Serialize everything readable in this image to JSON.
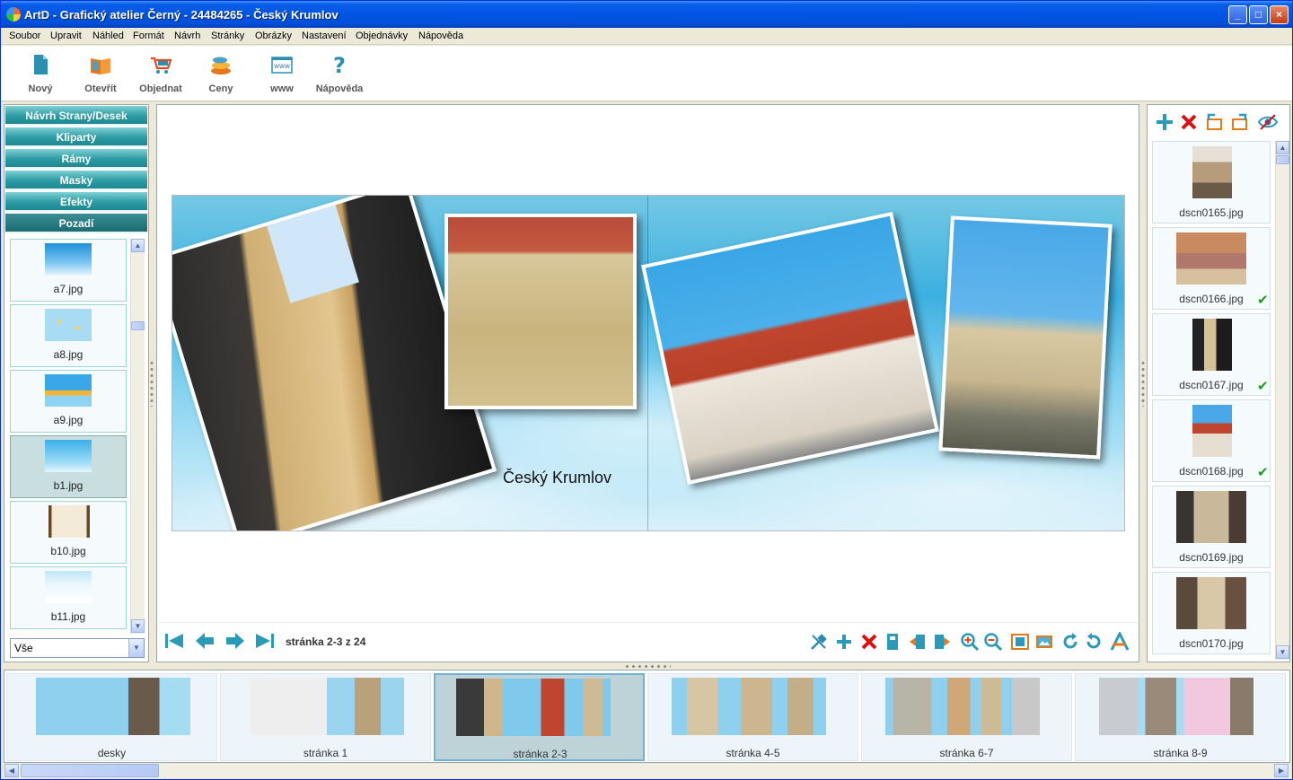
{
  "window": {
    "title": "ArtD - Grafický atelier Černý - 24484265 - Český Krumlov",
    "minimize": "_",
    "maximize": "□",
    "close": "×"
  },
  "menu": [
    "Soubor",
    "Upravit",
    "Náhled",
    "Formát",
    "Návrh",
    "Stránky",
    "Obrázky",
    "Nastavení",
    "Objednávky",
    "Nápověda"
  ],
  "toolbar": [
    {
      "label": "Nový",
      "icon": "new-document-icon"
    },
    {
      "label": "Otevřít",
      "icon": "open-book-icon"
    },
    {
      "label": "Objednat",
      "icon": "shopping-cart-icon"
    },
    {
      "label": "Ceny",
      "icon": "coins-icon"
    },
    {
      "label": "www",
      "icon": "web-browser-icon"
    },
    {
      "label": "Nápověda",
      "icon": "help-question-icon"
    }
  ],
  "left_panel": {
    "categories": [
      "Návrh Strany/Desek",
      "Kliparty",
      "Rámy",
      "Masky",
      "Efekty",
      "Pozadí"
    ],
    "active_category": "Pozadí",
    "backgrounds": [
      {
        "name": "a7.jpg"
      },
      {
        "name": "a8.jpg"
      },
      {
        "name": "a9.jpg"
      },
      {
        "name": "b1.jpg",
        "selected": true
      },
      {
        "name": "b10.jpg"
      },
      {
        "name": "b11.jpg"
      }
    ],
    "filter": "Vše"
  },
  "canvas": {
    "caption": "Český Krumlov",
    "page_indicator": "stránka 2-3 z 24"
  },
  "right_panel": {
    "photos": [
      {
        "name": "dscn0165.jpg",
        "used": false
      },
      {
        "name": "dscn0166.jpg",
        "used": true
      },
      {
        "name": "dscn0167.jpg",
        "used": true
      },
      {
        "name": "dscn0168.jpg",
        "used": true
      },
      {
        "name": "dscn0169.jpg",
        "used": false
      },
      {
        "name": "dscn0170.jpg",
        "used": false
      }
    ],
    "check": "✔"
  },
  "filmstrip": [
    {
      "label": "desky"
    },
    {
      "label": "stránka 1"
    },
    {
      "label": "stránka 2-3",
      "selected": true
    },
    {
      "label": "stránka 4-5"
    },
    {
      "label": "stránka 6-7"
    },
    {
      "label": "stránka 8-9"
    }
  ],
  "colors": {
    "accent": "#2d9ca3",
    "title_bar": "#0054e3",
    "check": "#1a9e1a",
    "delete": "#dd1111"
  }
}
